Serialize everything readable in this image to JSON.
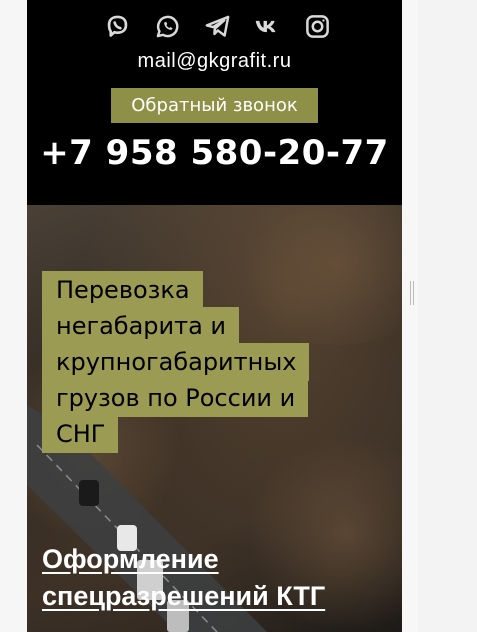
{
  "header": {
    "social": [
      {
        "name": "viber-icon"
      },
      {
        "name": "whatsapp-icon"
      },
      {
        "name": "telegram-icon"
      },
      {
        "name": "vk-icon"
      },
      {
        "name": "instagram-icon"
      }
    ],
    "email": "mail@gkgrafit.ru",
    "callback_label": "Обратный звонок",
    "phone": "+7 958 580-20-77"
  },
  "hero": {
    "title": "Перевозка негабарита и крупногабаритных грузов по России и СНГ",
    "subtitle": "Оформление спецразрешений КТГ"
  },
  "colors": {
    "accent": "#9c9b53",
    "button": "#8e9047",
    "header_bg": "#000000",
    "icon": "#d9d9d9"
  }
}
